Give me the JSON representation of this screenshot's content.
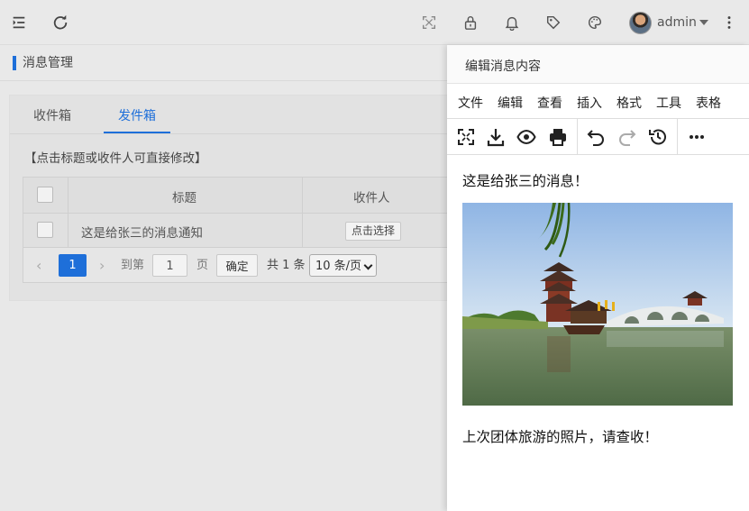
{
  "header": {
    "user_name": "admin",
    "icons": [
      "collapse-menu-icon",
      "refresh-icon",
      "fullscreen-icon",
      "lock-icon",
      "bell-icon",
      "tag-icon",
      "palette-icon",
      "more-vertical-icon"
    ]
  },
  "page": {
    "title": "消息管理"
  },
  "tabs": [
    {
      "label": "收件箱"
    },
    {
      "label": "发件箱",
      "active": true
    }
  ],
  "hint": "【点击标题或收件人可直接修改】",
  "table": {
    "columns": [
      "标题",
      "收件人"
    ],
    "rows": [
      {
        "title": "这是给张三的消息通知",
        "recipient_button": "点击选择"
      }
    ]
  },
  "pager": {
    "current_page": "1",
    "goto_label": "到第",
    "goto_value": "1",
    "page_label": "页",
    "confirm_label": "确定",
    "total_label": "共 1 条",
    "page_size": "10 条/页"
  },
  "editor": {
    "title": "编辑消息内容",
    "menus": [
      "文件",
      "编辑",
      "查看",
      "插入",
      "格式",
      "工具",
      "表格"
    ],
    "toolbar_icons": [
      "fullscreen-icon",
      "download-icon",
      "preview-icon",
      "print-icon",
      "undo-icon",
      "redo-icon",
      "history-icon",
      "more-icon"
    ],
    "content": {
      "line1": "这是给张三的消息！",
      "line2": "上次团体旅游的照片，请查收！"
    }
  },
  "colors": {
    "accent": "#1e6fd9"
  }
}
